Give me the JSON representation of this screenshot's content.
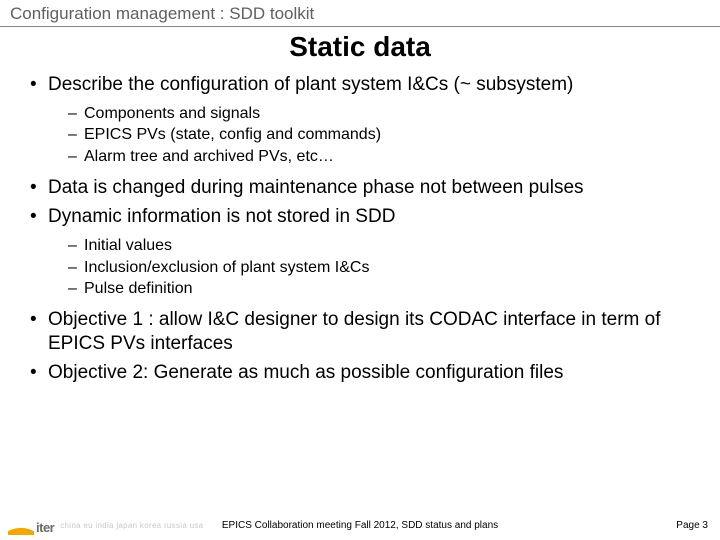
{
  "header": "Configuration management : SDD toolkit",
  "title": "Static data",
  "bullets": [
    {
      "text": "Describe the configuration of plant system I&Cs (~ subsystem)",
      "sub": [
        "Components and signals",
        "EPICS PVs (state, config and commands)",
        "Alarm tree and archived PVs, etc…"
      ]
    },
    {
      "text": "Data is changed during maintenance phase not between pulses",
      "sub": []
    },
    {
      "text": "Dynamic information is not stored in SDD",
      "sub": [
        "Initial values",
        "Inclusion/exclusion of plant system I&Cs",
        "Pulse definition"
      ]
    },
    {
      "text": "Objective 1 : allow I&C designer to design its CODAC interface in term of EPICS PVs interfaces",
      "sub": []
    },
    {
      "text": "Objective 2: Generate as much as possible configuration files",
      "sub": []
    }
  ],
  "footer": {
    "logo_text": "iter",
    "countries": "china eu india japan korea russia usa",
    "center": "EPICS Collaboration meeting  Fall 2012, SDD status and plans",
    "page": "Page 3"
  }
}
